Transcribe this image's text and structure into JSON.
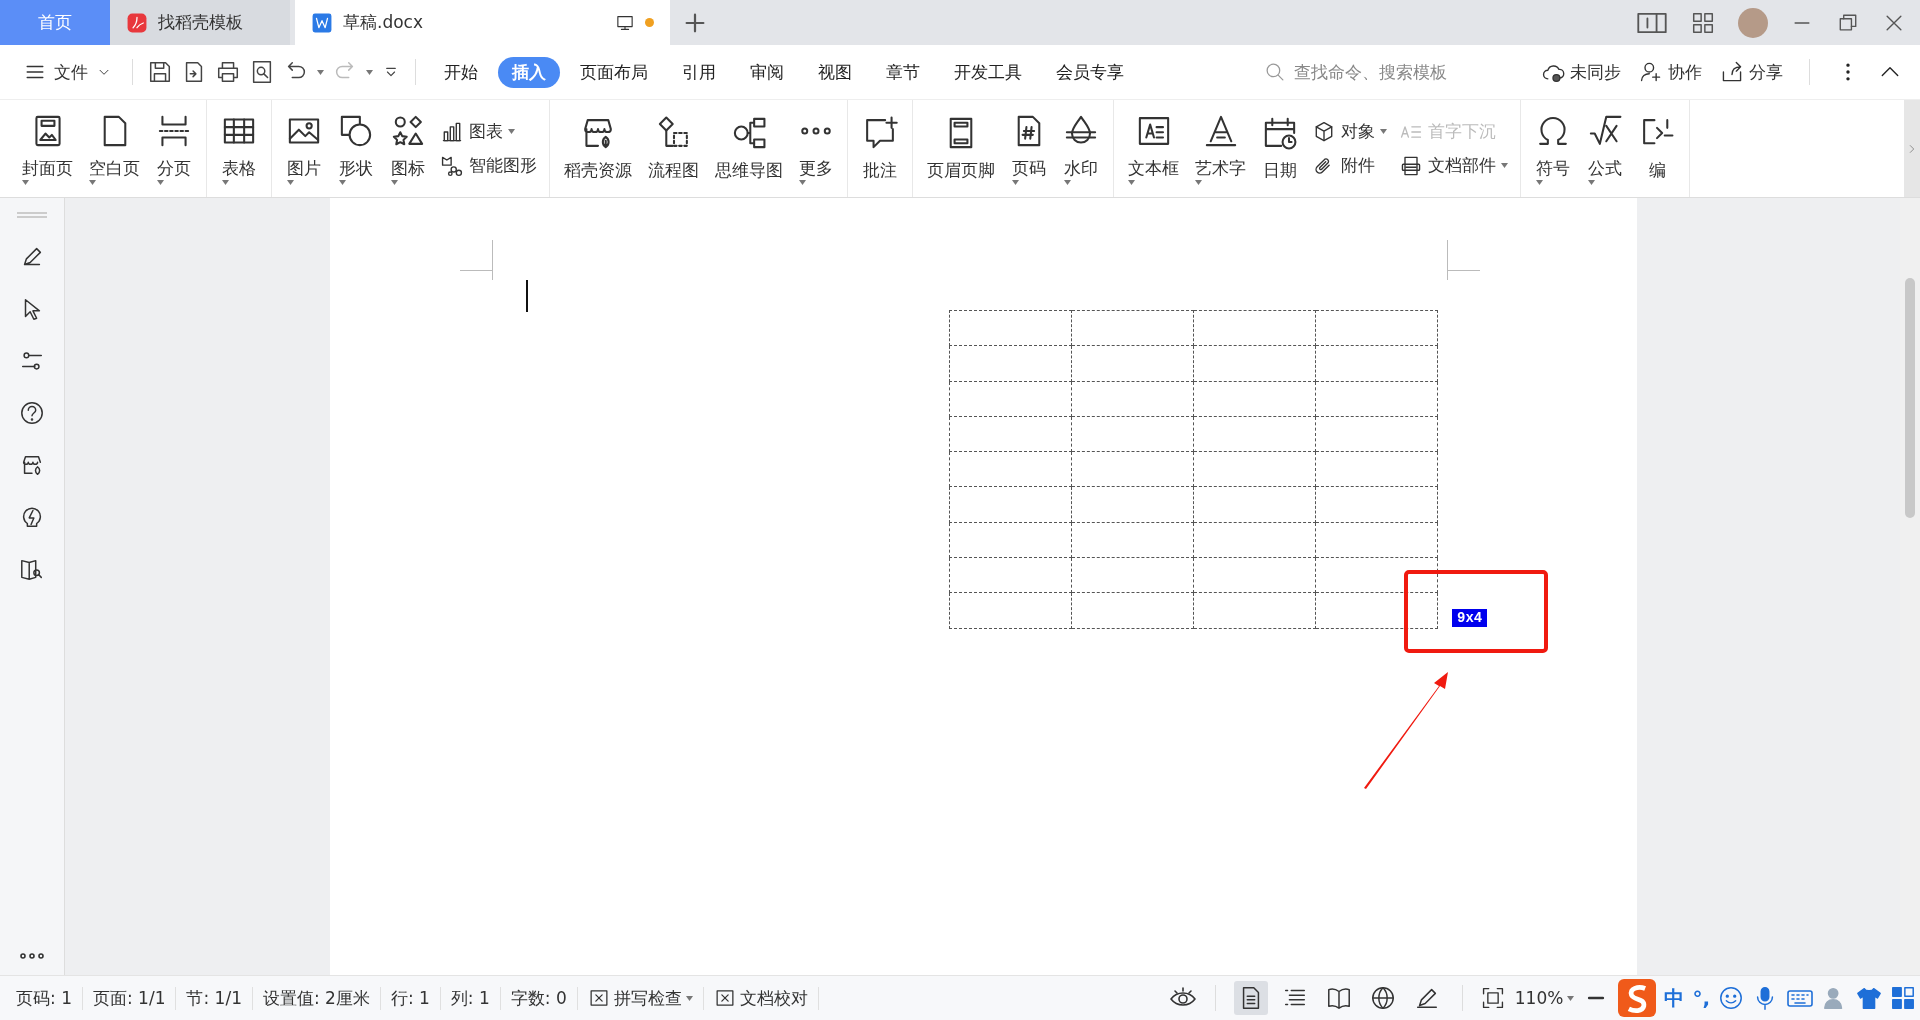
{
  "tabs": [
    {
      "label": "首页",
      "kind": "home",
      "selected": false,
      "modified": false
    },
    {
      "label": "找稻壳模板",
      "kind": "docer",
      "selected": false,
      "modified": false
    },
    {
      "label": "草稿.docx",
      "kind": "doc",
      "selected": true,
      "modified": true
    }
  ],
  "menu": {
    "file": "文件",
    "tabs": [
      {
        "label": "开始",
        "selected": false
      },
      {
        "label": "插入",
        "selected": true
      },
      {
        "label": "页面布局",
        "selected": false
      },
      {
        "label": "引用",
        "selected": false
      },
      {
        "label": "审阅",
        "selected": false
      },
      {
        "label": "视图",
        "selected": false
      },
      {
        "label": "章节",
        "selected": false
      },
      {
        "label": "开发工具",
        "selected": false
      },
      {
        "label": "会员专享",
        "selected": false
      }
    ],
    "search": {
      "placeholder": "查找命令、搜索模板"
    },
    "actions": [
      "未同步",
      "协作",
      "分享"
    ]
  },
  "ribbon": [
    {
      "items": [
        {
          "kind": "large",
          "label": "封面页",
          "dropdown": true
        },
        {
          "kind": "large",
          "label": "空白页",
          "dropdown": true
        },
        {
          "kind": "large",
          "label": "分页",
          "dropdown": true
        }
      ]
    },
    {
      "items": [
        {
          "kind": "large",
          "label": "表格",
          "dropdown": true
        }
      ]
    },
    {
      "items": [
        {
          "kind": "large",
          "label": "图片",
          "dropdown": true
        },
        {
          "kind": "large",
          "label": "形状",
          "dropdown": true
        },
        {
          "kind": "large",
          "label": "图标",
          "dropdown": true
        },
        {
          "kind": "stack",
          "items": [
            {
              "label": "图表",
              "dropdown": true,
              "disabled": false
            },
            {
              "label": "智能图形",
              "dropdown": false,
              "disabled": false
            }
          ]
        }
      ]
    },
    {
      "items": [
        {
          "kind": "large",
          "label": "稻壳资源",
          "dropdown": false
        },
        {
          "kind": "large",
          "label": "流程图",
          "dropdown": false
        },
        {
          "kind": "large",
          "label": "思维导图",
          "dropdown": false
        },
        {
          "kind": "large",
          "label": "更多",
          "dropdown": true
        }
      ]
    },
    {
      "items": [
        {
          "kind": "large",
          "label": "批注",
          "dropdown": false
        }
      ]
    },
    {
      "items": [
        {
          "kind": "large",
          "label": "页眉页脚",
          "dropdown": false
        },
        {
          "kind": "large",
          "label": "页码",
          "dropdown": true
        },
        {
          "kind": "large",
          "label": "水印",
          "dropdown": true
        }
      ]
    },
    {
      "items": [
        {
          "kind": "large",
          "label": "文本框",
          "dropdown": true
        },
        {
          "kind": "large",
          "label": "艺术字",
          "dropdown": true
        },
        {
          "kind": "large",
          "label": "日期",
          "dropdown": false
        },
        {
          "kind": "stack",
          "items": [
            {
              "label": "对象",
              "dropdown": true,
              "disabled": false
            },
            {
              "label": "附件",
              "dropdown": false,
              "disabled": false
            }
          ]
        },
        {
          "kind": "stack",
          "items": [
            {
              "label": "首字下沉",
              "dropdown": false,
              "disabled": true
            },
            {
              "label": "文档部件",
              "dropdown": true,
              "disabled": false
            }
          ]
        }
      ]
    },
    {
      "items": [
        {
          "kind": "large",
          "label": "符号",
          "dropdown": true
        },
        {
          "kind": "large",
          "label": "公式",
          "dropdown": true
        },
        {
          "kind": "large",
          "label": "编",
          "dropdown": false
        }
      ]
    }
  ],
  "table": {
    "size_label": "9x4"
  },
  "status_bar": {
    "items": [
      "页码: 1",
      "页面: 1/1",
      "节: 1/1",
      "设置值: 2厘米",
      "行: 1",
      "列: 1",
      "字数: 0"
    ],
    "tools": [
      {
        "label": "拼写检查",
        "dropdown": true
      },
      {
        "label": "文档校对",
        "dropdown": false
      }
    ],
    "view_modes": [
      {
        "selected": true
      },
      {
        "selected": false
      },
      {
        "selected": false
      },
      {
        "selected": false
      },
      {
        "selected": false
      }
    ],
    "zoom": "110%",
    "ime": {
      "language": "中",
      "punctuation": "°,"
    }
  }
}
